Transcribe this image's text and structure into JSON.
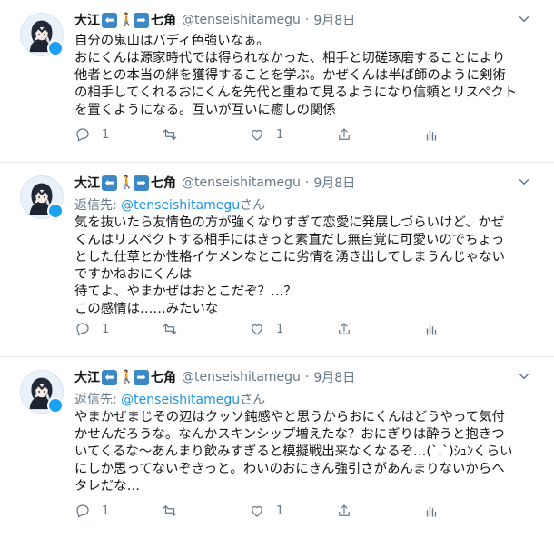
{
  "tweets": [
    {
      "name": "大江",
      "name_suffix": "七角",
      "handle": "@tenseishitamegu",
      "separator": "·",
      "date": "9月8日",
      "reply_label": "",
      "reply_handle": "",
      "reply_suffix": "",
      "lines": [
        "自分の鬼山はバディ色強いなぁ。",
        "おにくんは源家時代では得られなかった、相手と切磋琢磨することにより",
        "他者との本当の絆を獲得することを学ぶ。かぜくんは半ば師のように剣術",
        "の相手してくれるおにくんを先代と重ねて見るようになり信頼とリスペクト",
        "を置くようになる。互いが互いに癒しの関係"
      ],
      "reply_count": "1",
      "retweet_count": "",
      "like_count": "1"
    },
    {
      "name": "大江",
      "name_suffix": "七角",
      "handle": "@tenseishitamegu",
      "separator": "·",
      "date": "9月8日",
      "reply_label": "返信先: ",
      "reply_handle": "@tenseishitamegu",
      "reply_suffix": "さん",
      "lines": [
        "気を抜いたら友情色の方が強くなりすぎて恋愛に発展しづらいけど、かぜ",
        "くんはリスペクトする相手にはきっと素直だし無自覚に可愛いのでちょっ",
        "とした仕草とか性格イケメンなとこに劣情を湧き出してしまうんじゃない",
        "ですかねおにくんは",
        "待てよ、やまかぜはおとこだぞ？…？",
        "この感情は……みたいな"
      ],
      "reply_count": "1",
      "retweet_count": "",
      "like_count": "1"
    },
    {
      "name": "大江",
      "name_suffix": "七角",
      "handle": "@tenseishitamegu",
      "separator": "·",
      "date": "9月8日",
      "reply_label": "返信先: ",
      "reply_handle": "@tenseishitamegu",
      "reply_suffix": "さん",
      "lines": [
        "やまかぜまじその辺はクッソ鈍感やと思うからおにくんはどうやって気付",
        "かせんだろうな。なんかスキンシップ増えたな？おにぎりは酔うと抱きつ",
        "いてくるな～あんまり飲みすぎると模擬戦出来なくなるぞ…(ˋ.ˋ)ｼｭﾝくらい",
        "にしか思ってないぞきっと。わいのおにきん強引さがあんまりないからヘ",
        "タレだな…"
      ],
      "reply_count": "1",
      "retweet_count": "",
      "like_count": "1"
    }
  ],
  "colors": {
    "text": "#14171a",
    "muted": "#657786",
    "link": "#1b95e0",
    "border": "#e6ecf0",
    "emoji_arrow": "#3b88c3"
  },
  "icons": [
    "avatar",
    "left-arrow-emoji",
    "walking-person-emoji",
    "right-arrow-emoji",
    "chevron-down-icon",
    "reply-icon",
    "retweet-icon",
    "like-icon",
    "share-icon",
    "analytics-icon"
  ]
}
